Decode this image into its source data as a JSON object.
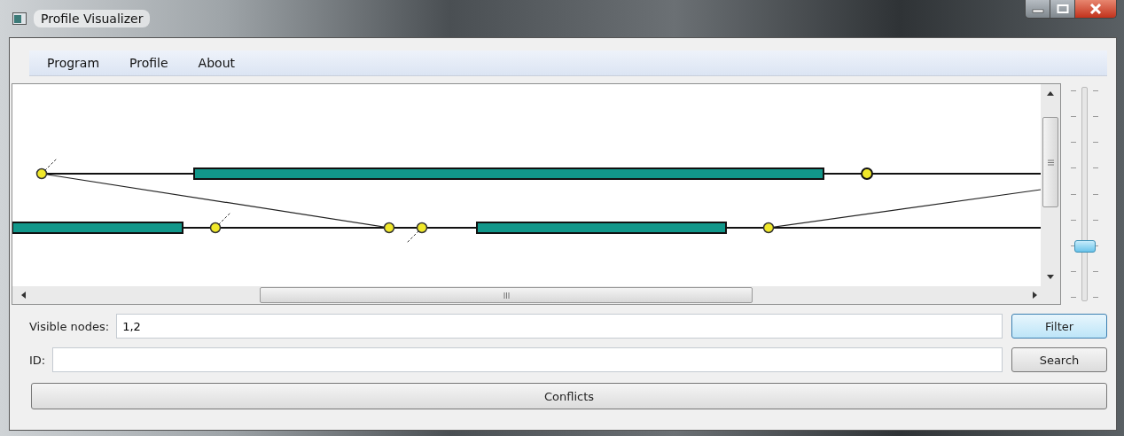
{
  "window": {
    "title": "Profile Visualizer"
  },
  "menu": [
    {
      "label": "Program"
    },
    {
      "label": "Profile"
    },
    {
      "label": "About"
    }
  ],
  "zoom_slider": {
    "level": 0.25
  },
  "filter_row": {
    "label": "Visible nodes:",
    "value": "1,2",
    "button": {
      "label": "Filter",
      "focused": true
    }
  },
  "search_row": {
    "label": "ID:",
    "button": {
      "label": "Search",
      "focused": false
    }
  },
  "conflicts_button": {
    "label": "Conflicts",
    "focused": false
  }
}
